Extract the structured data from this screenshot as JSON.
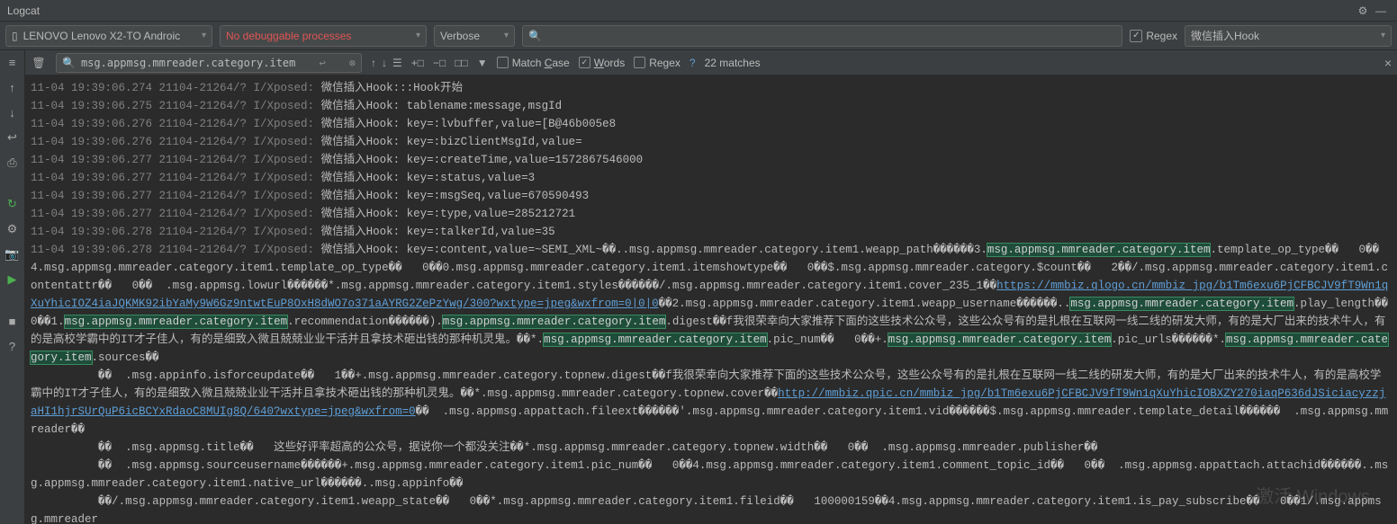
{
  "title": "Logcat",
  "toolbar": {
    "device": "LENOVO Lenovo X2-TO Androic",
    "process": "No debuggable processes",
    "level": "Verbose",
    "regex_label": "Regex",
    "regex_checked": true,
    "filter": "微信插入Hook"
  },
  "find": {
    "query": "msg.appmsg.mmreader.category.item",
    "match_case_label": "Match Case",
    "words_label": "Words",
    "regex_label": "Regex",
    "words_checked": true,
    "matches": "22 matches"
  },
  "logs": [
    {
      "ts": "11-04 19:39:06.274 21104-21264/? I/Xposed:",
      "tag": "微信插入Hook:",
      "msg": "::Hook开始"
    },
    {
      "ts": "11-04 19:39:06.275 21104-21264/? I/Xposed:",
      "tag": "微信插入Hook:",
      "msg": " tablename:message,msgId"
    },
    {
      "ts": "11-04 19:39:06.276 21104-21264/? I/Xposed:",
      "tag": "微信插入Hook:",
      "msg": " key=:lvbuffer,value=[B@46b005e8"
    },
    {
      "ts": "11-04 19:39:06.276 21104-21264/? I/Xposed:",
      "tag": "微信插入Hook:",
      "msg": " key=:bizClientMsgId,value="
    },
    {
      "ts": "11-04 19:39:06.277 21104-21264/? I/Xposed:",
      "tag": "微信插入Hook:",
      "msg": " key=:createTime,value=1572867546000"
    },
    {
      "ts": "11-04 19:39:06.277 21104-21264/? I/Xposed:",
      "tag": "微信插入Hook:",
      "msg": " key=:status,value=3"
    },
    {
      "ts": "11-04 19:39:06.277 21104-21264/? I/Xposed:",
      "tag": "微信插入Hook:",
      "msg": " key=:msgSeq,value=670590493"
    },
    {
      "ts": "11-04 19:39:06.277 21104-21264/? I/Xposed:",
      "tag": "微信插入Hook:",
      "msg": " key=:type,value=285212721"
    },
    {
      "ts": "11-04 19:39:06.278 21104-21264/? I/Xposed:",
      "tag": "微信插入Hook:",
      "msg": " key=:talkerId,value=35"
    }
  ],
  "bigblock": {
    "prefix_ts": "11-04 19:39:06.278 21104-21264/? I/Xposed:",
    "prefix_tag": "微信插入Hook:",
    "s0": " key=:content,value=~SEMI_XML~��..msg.appmsg.mmreader.category.item1.weapp_path������3.",
    "hl0": "msg.appmsg.mmreader.category.item",
    "s1": ".template_op_type��   0��4.msg.appmsg.mmreader.category.item1.template_op_type��   0��0.msg.appmsg.mmreader.category.item1.itemshowtype��   0��$.msg.appmsg.mmreader.category.$count��   2��/.msg.appmsg.mmreader.category.item1.contentattr��   0��  .msg.appmsg.lowurl������*.msg.appmsg.mmreader.category.item1.styles������/.msg.appmsg.mmreader.category.item1.cover_235_1��",
    "link0": "https://mmbiz.qlogo.cn/mmbiz_jpg/b1Tm6exu6PjCFBCJV9fT9Wn1qXuYhicIOZ4iaJQKMK92ibYaMy9W6Gz9ntwtEuP8OxH8dWO7o371aAYRG2ZePzYwg/300?wxtype=jpeg&wxfrom=0|0|0",
    "s2": "��2.msg.appmsg.mmreader.category.item1.weapp_username������..",
    "hl1": "msg.appmsg.mmreader.category.item",
    "s3": ".play_length��   0��1.",
    "hl2": "msg.appmsg.mmreader.category.item",
    "s4": ".recommendation������).",
    "hl3": "msg.appmsg.mmreader.category.item",
    "s5": ".digest��f我很荣幸向大家推荐下面的这些技术公众号，这些公众号有的是扎根在互联网一线二线的研发大师，有的是大厂出来的技术牛人，有的是高校学霸中的IT才子佳人，有的是细致入微且兢兢业业干活并且拿技术砸出钱的那种机灵鬼。��*.",
    "hl4": "msg.appmsg.mmreader.category.item",
    "s6": ".pic_num��   0��+.",
    "hl5": "msg.appmsg.mmreader.category.item",
    "s7": ".pic_urls������*.",
    "hl6": "msg.appmsg.mmreader.category.item",
    "s8": ".sources��",
    "s9": "          ��  .msg.appinfo.isforceupdate��   1��+.msg.appmsg.mmreader.category.topnew.digest��f我很荣幸向大家推荐下面的这些技术公众号，这些公众号有的是扎根在互联网一线二线的研发大师，有的是大厂出来的技术牛人，有的是高校学霸中的IT才子佳人，有的是细致入微且兢兢业业干活并且拿技术砸出钱的那种机灵鬼。��*.msg.appmsg.mmreader.category.topnew.cover��",
    "link1": "http://mmbiz.qpic.cn/mmbiz_jpg/b1Tm6exu6PjCFBCJV9fT9Wn1qXuYhicIOBXZY270iaqP636dJSiciacyzzjaHI1hjrSUrQuP6icBCYxRdaoC8MUIg8Q/640?wxtype=jpeg&wxfrom=0",
    "s10": "��  .msg.appmsg.appattach.fileext������'.msg.appmsg.mmreader.category.item1.vid������$.msg.appmsg.mmreader.template_detail������  .msg.appmsg.mmreader��",
    "s11": "          ��  .msg.appmsg.title��   这些好评率超高的公众号，据说你一个都没关注��*.msg.appmsg.mmreader.category.topnew.width��   0��  .msg.appmsg.mmreader.publisher��",
    "s12": "          ��  .msg.appmsg.sourceusername������+.msg.appmsg.mmreader.category.item1.pic_num��   0��4.msg.appmsg.mmreader.category.item1.comment_topic_id��   0��  .msg.appmsg.appattach.attachid������..msg.appmsg.mmreader.category.item1.native_url������..msg.appinfo��",
    "s13": "          ��/.msg.appmsg.mmreader.category.item1.weapp_state��   0��*.msg.appmsg.mmreader.category.item1.fileid��   100000159��4.msg.appmsg.mmreader.category.item1.is_pay_subscribe��   0��1/.msg.appmsg.mmreader"
  },
  "watermark": "激活 Windows"
}
